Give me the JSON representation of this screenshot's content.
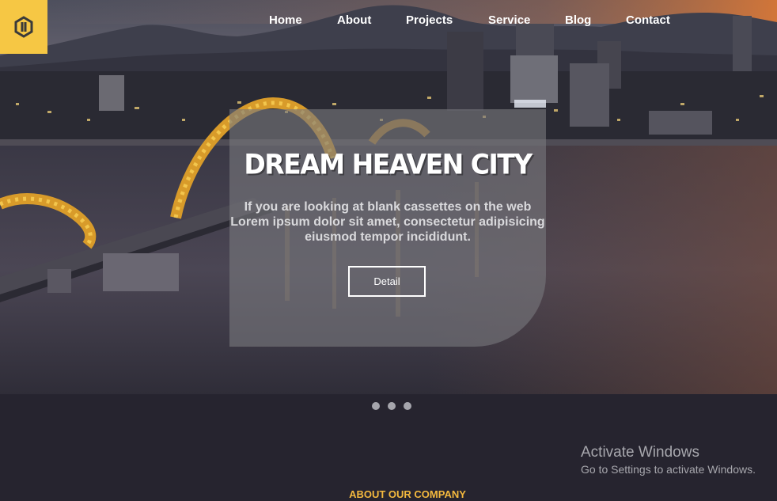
{
  "nav": {
    "items": [
      "Home",
      "About",
      "Projects",
      "Service",
      "Blog",
      "Contact"
    ]
  },
  "hero": {
    "title": "DREAM HEAVEN CITY",
    "lines": [
      "If you are looking at blank cassettes on the web",
      "Lorem ipsum dolor sit amet, consectetur adipisicing",
      "eiusmod tempor incididunt."
    ],
    "button": "Detail"
  },
  "carousel": {
    "slides": 3,
    "active": 1
  },
  "watermark": {
    "title": "Activate Windows",
    "subtitle": "Go to Settings to activate Windows."
  },
  "section": {
    "heading": "ABOUT OUR COMPANY"
  },
  "colors": {
    "accent": "#f6c744",
    "page_bg": "#26242f",
    "heading": "#f4b93e"
  },
  "icons": {
    "logo": "hexagon-logo-icon"
  }
}
